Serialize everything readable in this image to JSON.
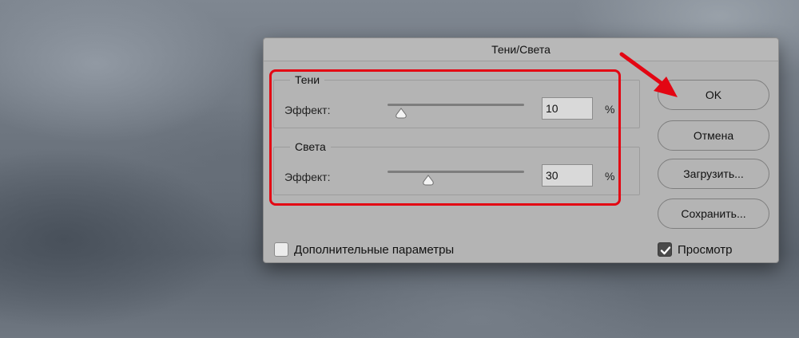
{
  "dialog": {
    "title": "Тени/Света",
    "shadows": {
      "group_label": "Тени",
      "effect_label": "Эффект:",
      "value": "10",
      "unit": "%",
      "level": 10
    },
    "highlights": {
      "group_label": "Света",
      "effect_label": "Эффект:",
      "value": "30",
      "unit": "%",
      "level": 30
    },
    "buttons": {
      "ok": "OK",
      "cancel": "Отмена",
      "load": "Загрузить...",
      "save": "Сохранить..."
    },
    "advanced": {
      "label": "Дополнительные параметры",
      "checked": false
    },
    "preview": {
      "label": "Просмотр",
      "checked": true
    }
  },
  "annotation": {
    "highlight_color": "#e30613",
    "arrow_color": "#e30613",
    "arrow_icon": "red-arrow-icon"
  },
  "colors": {
    "dialog_bg": "#b4b4b4",
    "field_bg": "#d9d9d9",
    "checkbox_checked": "#4a4a4a"
  }
}
